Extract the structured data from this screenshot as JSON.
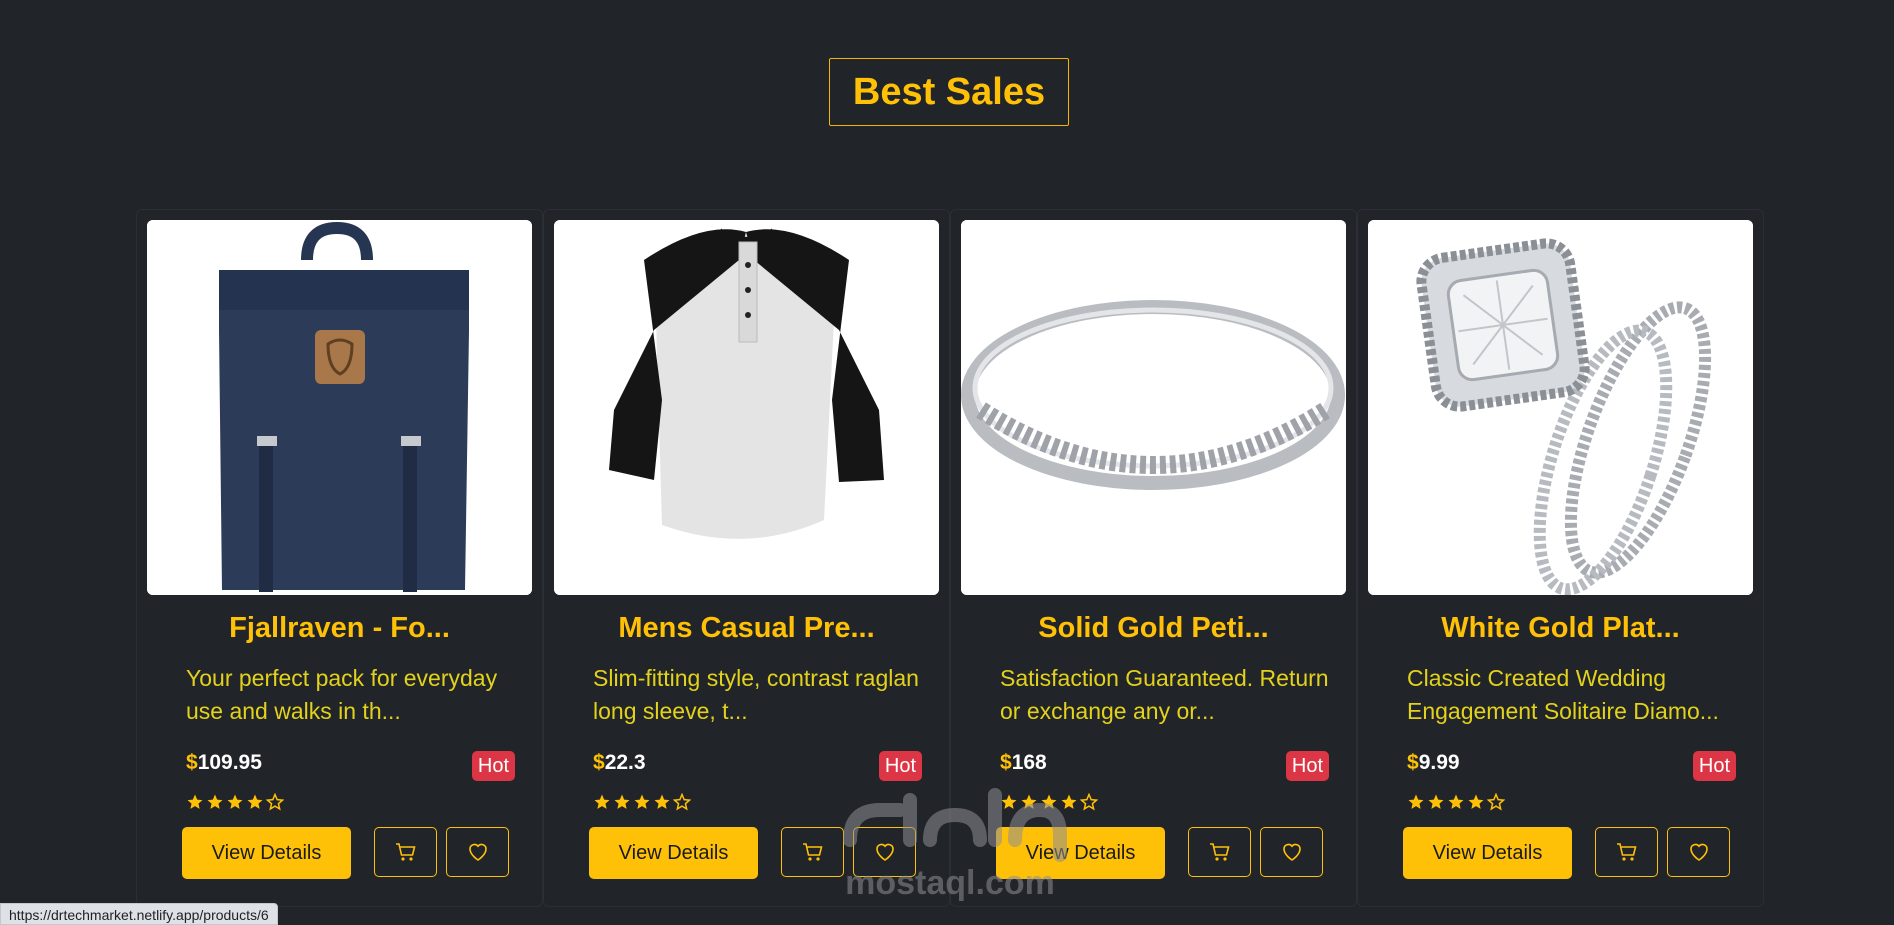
{
  "section": {
    "title": "Best Sales"
  },
  "currency_symbol": "$",
  "view_label": "View Details",
  "products": [
    {
      "title": "Fjallraven - Fo...",
      "description": "Your perfect pack for everyday use and walks in th...",
      "price": "109.95",
      "badge": "Hot",
      "rating": 4,
      "image": "backpack"
    },
    {
      "title": "Mens Casual Pre...",
      "description": "Slim-fitting style, contrast raglan long sleeve, t...",
      "price": "22.3",
      "badge": "Hot",
      "rating": 4,
      "image": "raglan-shirt"
    },
    {
      "title": "Solid Gold Peti...",
      "description": "Satisfaction Guaranteed. Return or exchange any or...",
      "price": "168",
      "badge": "Hot",
      "rating": 4,
      "image": "silver-ring"
    },
    {
      "title": "White Gold Plat...",
      "description": "Classic Created Wedding Engagement Solitaire Diamo...",
      "price": "9.99",
      "badge": "Hot",
      "rating": 4,
      "image": "diamond-ring-set"
    }
  ],
  "status_bar": {
    "url": "https://drtechmarket.netlify.app/products/6"
  },
  "watermark": {
    "text": "mostaql.com"
  },
  "colors": {
    "background": "#212429",
    "accent": "#ffc107",
    "description": "#e3d21c",
    "badge": "#dc3545"
  },
  "icons": [
    "star-icon",
    "cart-icon",
    "heart-icon"
  ]
}
